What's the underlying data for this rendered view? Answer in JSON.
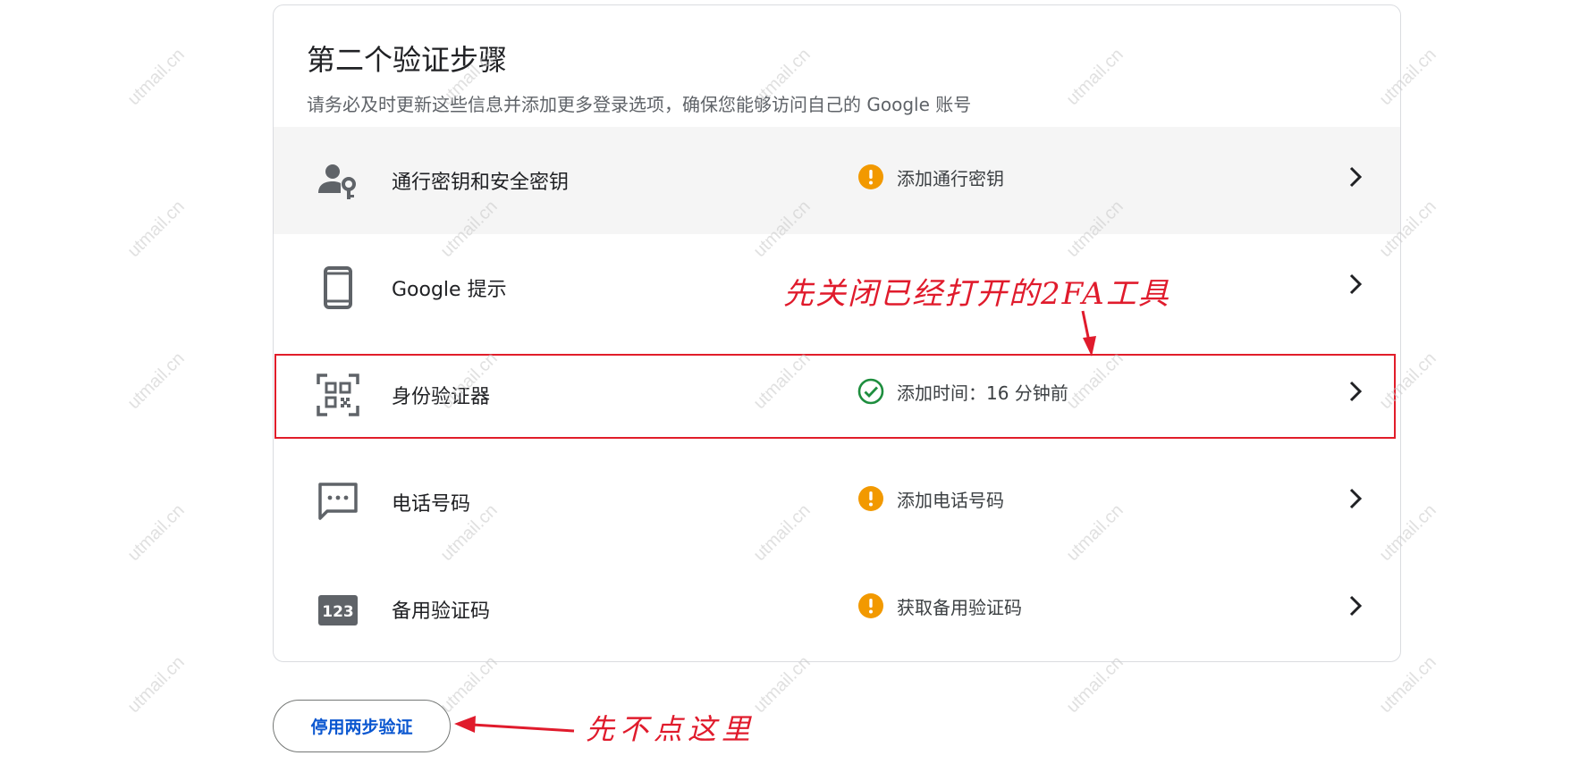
{
  "section": {
    "title": "第二个验证步骤",
    "subtitle": "请务必及时更新这些信息并添加更多登录选项，确保您能够访问自己的 Google 账号"
  },
  "rows": [
    {
      "name": "通行密钥和安全密钥",
      "status": "添加通行密钥",
      "status_icon": "warning-icon",
      "icon": "person-key-icon"
    },
    {
      "name": "Google 提示",
      "status": "",
      "status_icon": "",
      "icon": "phone-icon"
    },
    {
      "name": "身份验证器",
      "status": "添加时间：16 分钟前",
      "status_icon": "check-circle-icon",
      "icon": "qr-code-icon"
    },
    {
      "name": "电话号码",
      "status": "添加电话号码",
      "status_icon": "warning-icon",
      "icon": "message-icon"
    },
    {
      "name": "备用验证码",
      "status": "获取备用验证码",
      "status_icon": "warning-icon",
      "icon": "code-123-icon",
      "icon_text": "123"
    }
  ],
  "actions": {
    "disable_label": "停用两步验证"
  },
  "annotations": {
    "close_2fa": "先关闭已经打开的2FA工具",
    "dont_click": "先不点这里"
  },
  "watermark": "utmail.cn",
  "colors": {
    "warning": "#f29900",
    "success": "#1e8e3e",
    "link": "#0b57d0",
    "annotation": "#e01b2c",
    "hover_row": "#f5f5f5"
  }
}
